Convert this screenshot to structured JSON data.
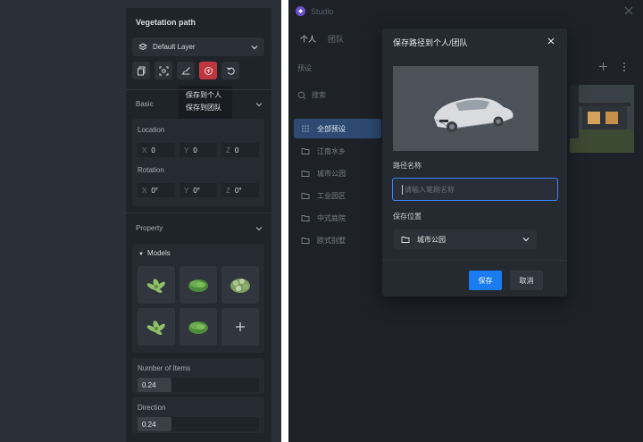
{
  "vegetation_panel": {
    "title": "Vegetation path",
    "layer_select": "Default Layer",
    "toolbar": [
      {
        "icon": "copy-icon"
      },
      {
        "icon": "focus-icon"
      },
      {
        "icon": "brush-icon"
      },
      {
        "icon": "save-icon",
        "active": true
      },
      {
        "icon": "undo-icon"
      }
    ],
    "save_menu": {
      "item_personal": "保存到个人",
      "item_team": "保存到团队"
    },
    "basic": {
      "header": "Basic",
      "location_label": "Location",
      "location": {
        "x": "0",
        "y": "0",
        "z": "0"
      },
      "rotation_label": "Rotation",
      "rotation": {
        "x": "0°",
        "y": "0°",
        "z": "0°"
      },
      "axis_x": "X",
      "axis_y": "Y",
      "axis_z": "Z"
    },
    "property": {
      "header": "Property",
      "models_label": "Models",
      "number_of_items_label": "Number of Items",
      "number_of_items": "0.24",
      "direction_label": "Direction",
      "direction": "0.24"
    }
  },
  "studio": {
    "app_title": "Studio",
    "tabs": [
      {
        "label": "个人",
        "active": true
      },
      {
        "label": "团队",
        "active": false
      }
    ],
    "presets_label": "预设",
    "search_placeholder": "搜索",
    "categories": [
      {
        "label": "全部预设",
        "active": true
      },
      {
        "label": "江南水乡",
        "active": false
      },
      {
        "label": "城市公园",
        "active": false
      },
      {
        "label": "工业园区",
        "active": false
      },
      {
        "label": "中式庭院",
        "active": false
      },
      {
        "label": "欧式别墅",
        "active": false
      }
    ]
  },
  "dialog": {
    "title": "保存路径到个人/团队",
    "name_label": "路径名称",
    "name_placeholder": "请输入笔刷名称",
    "location_label": "保存位置",
    "location_value": "城市公园",
    "save_button": "保存",
    "cancel_button": "取消"
  },
  "colors": {
    "accent": "#1a7cf0",
    "active_tool": "#c0363f",
    "active_category": "#2e4a72"
  }
}
